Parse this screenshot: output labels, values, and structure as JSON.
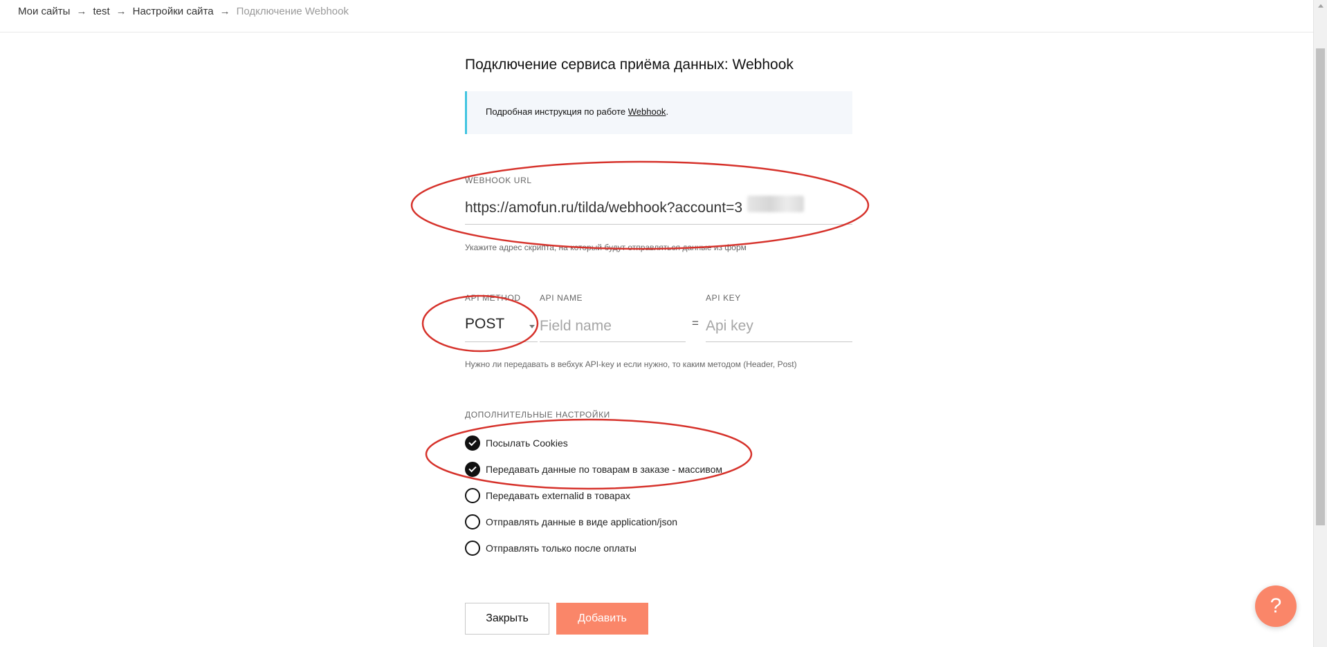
{
  "breadcrumb": {
    "items": [
      "Мои сайты",
      "test",
      "Настройки сайта"
    ],
    "current": "Подключение Webhook",
    "separator": "→"
  },
  "page": {
    "title": "Подключение сервиса приёма данных: Webhook"
  },
  "info": {
    "text": "Подробная инструкция по работе ",
    "link": "Webhook",
    "suffix": "."
  },
  "webhook": {
    "label": "WEBHOOK URL",
    "value": "https://amofun.ru/tilda/webhook?account=3",
    "hint": "Укажите адрес скрипта, на который будут отправляться данные из форм"
  },
  "api": {
    "method_label": "API METHOD",
    "method_value": "POST",
    "name_label": "API NAME",
    "name_placeholder": "Field name",
    "equals": "=",
    "key_label": "API KEY",
    "key_placeholder": "Api key",
    "hint": "Нужно ли передавать в вебхук API-key и если нужно, то каким методом (Header, Post)"
  },
  "extra": {
    "label": "ДОПОЛНИТЕЛЬНЫЕ НАСТРОЙКИ",
    "options": [
      {
        "label": "Посылать Cookies",
        "checked": true
      },
      {
        "label": "Передавать данные по товарам в заказе - массивом",
        "checked": true
      },
      {
        "label": "Передавать externalid в товарах",
        "checked": false
      },
      {
        "label": "Отправлять данные в виде application/json",
        "checked": false
      },
      {
        "label": "Отправлять только после оплаты",
        "checked": false
      }
    ]
  },
  "buttons": {
    "close": "Закрыть",
    "add": "Добавить"
  },
  "help": {
    "label": "?"
  },
  "colors": {
    "accent": "#fa8669",
    "info_border": "#40c4e0",
    "annotation": "#d6322b"
  }
}
